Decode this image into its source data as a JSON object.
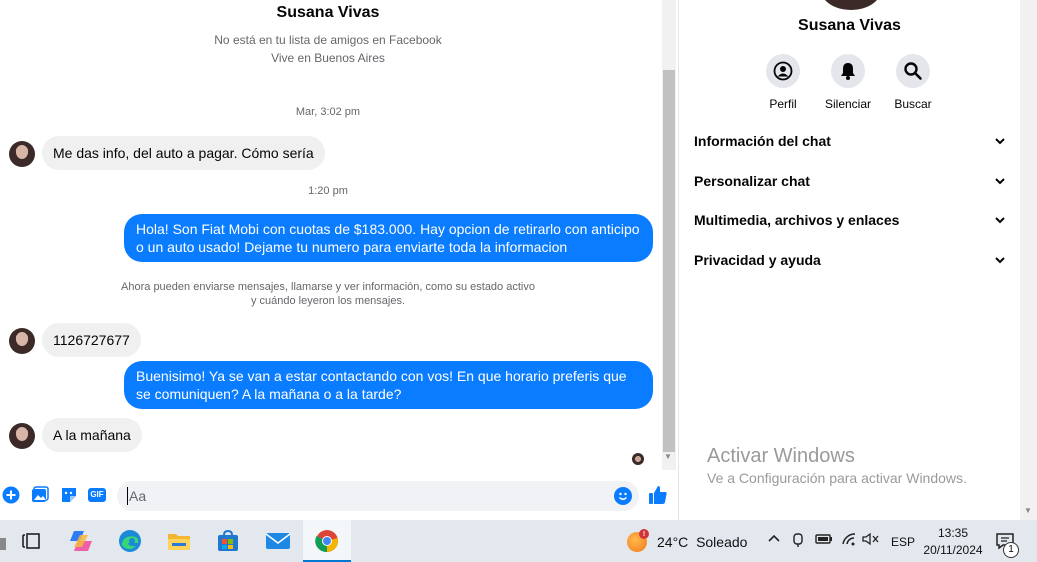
{
  "chat": {
    "contact_name": "Susana Vivas",
    "not_friend": "No está en tu lista de amigos en Facebook",
    "location": "Vive en Buenos Aires",
    "messages": [
      {
        "kind": "timestamp",
        "text": "Mar, 3:02 pm"
      },
      {
        "kind": "in",
        "text": "Me das info, del auto a pagar. Cómo sería"
      },
      {
        "kind": "timestamp",
        "text": "1:20 pm"
      },
      {
        "kind": "out",
        "text": "Hola! Son Fiat Mobi con cuotas de $183.000. Hay opcion de retirarlo con anticipo o un auto usado! Dejame tu numero para enviarte toda la informacion"
      },
      {
        "kind": "notice",
        "line1": "Ahora pueden enviarse mensajes, llamarse y ver información, como su estado activo",
        "line2": "y cuándo leyeron los mensajes."
      },
      {
        "kind": "in",
        "text": "1126727677"
      },
      {
        "kind": "out",
        "text": "Buenisimo! Ya se van a estar contactando con vos! En que horario preferis que se comuniquen? A la mañana o a la tarde?"
      },
      {
        "kind": "in",
        "text": "A la mañana"
      }
    ]
  },
  "composer": {
    "placeholder": "Aa",
    "gif_label": "GIF",
    "icons": [
      "plus-icon",
      "photo-icon",
      "sticker-icon",
      "gif-icon",
      "emoji-icon",
      "thumbs-up-icon"
    ]
  },
  "panel": {
    "name": "Susana Vivas",
    "actions": [
      {
        "label": "Perfil",
        "icon": "profile-icon"
      },
      {
        "label": "Silenciar",
        "icon": "bell-icon"
      },
      {
        "label": "Buscar",
        "icon": "search-icon"
      }
    ],
    "sections": [
      "Información del chat",
      "Personalizar chat",
      "Multimedia, archivos y enlaces",
      "Privacidad y ayuda"
    ],
    "watermark_title": "Activar Windows",
    "watermark_sub": "Ve a Configuración para activar Windows."
  },
  "taskbar": {
    "weather_temp": "24°C",
    "weather_desc": "Soleado",
    "weather_badge": "!",
    "language": "ESP",
    "time": "13:35",
    "date": "20/11/2024",
    "notification_count": "1",
    "apps": [
      "task-view",
      "copilot",
      "edge",
      "file-explorer",
      "store",
      "mail",
      "chrome"
    ],
    "accent": "#0078d4"
  },
  "colors": {
    "messenger_blue": "#0a7cff",
    "bubble_gray": "#f0f0f0",
    "secondary_text": "#65676b"
  }
}
